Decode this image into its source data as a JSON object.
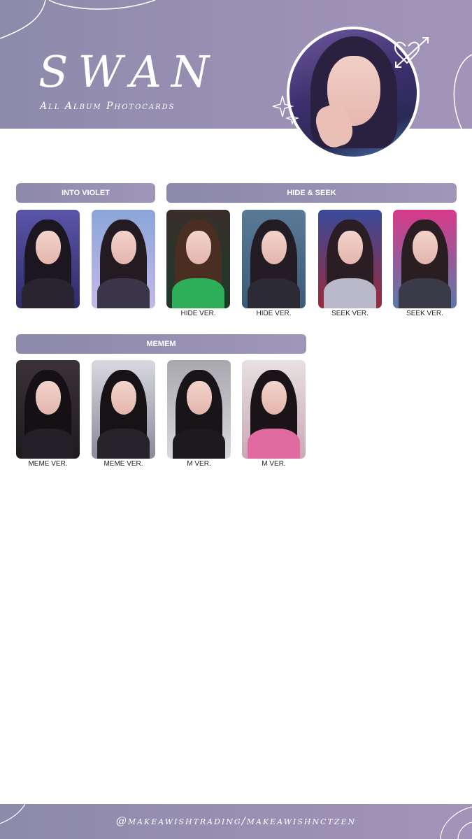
{
  "header": {
    "title": "SWAN",
    "subtitle": "All Album Photocards"
  },
  "sections": [
    {
      "label": "INTO VIOLET"
    },
    {
      "label": "HIDE & SEEK"
    },
    {
      "label": "MEMEM"
    }
  ],
  "cards": {
    "into_violet": [
      "",
      ""
    ],
    "hide_seek": [
      "HIDE VER.",
      "HIDE VER.",
      "SEEK VER.",
      "SEEK VER."
    ],
    "memem": [
      "MEME VER.",
      "MEME VER.",
      "M VER.",
      "M VER."
    ]
  },
  "footer": {
    "text": "@makeawishtrading/makeawishnctzen"
  },
  "colors": {
    "accent": "#9a90b4",
    "text": "#222222"
  }
}
